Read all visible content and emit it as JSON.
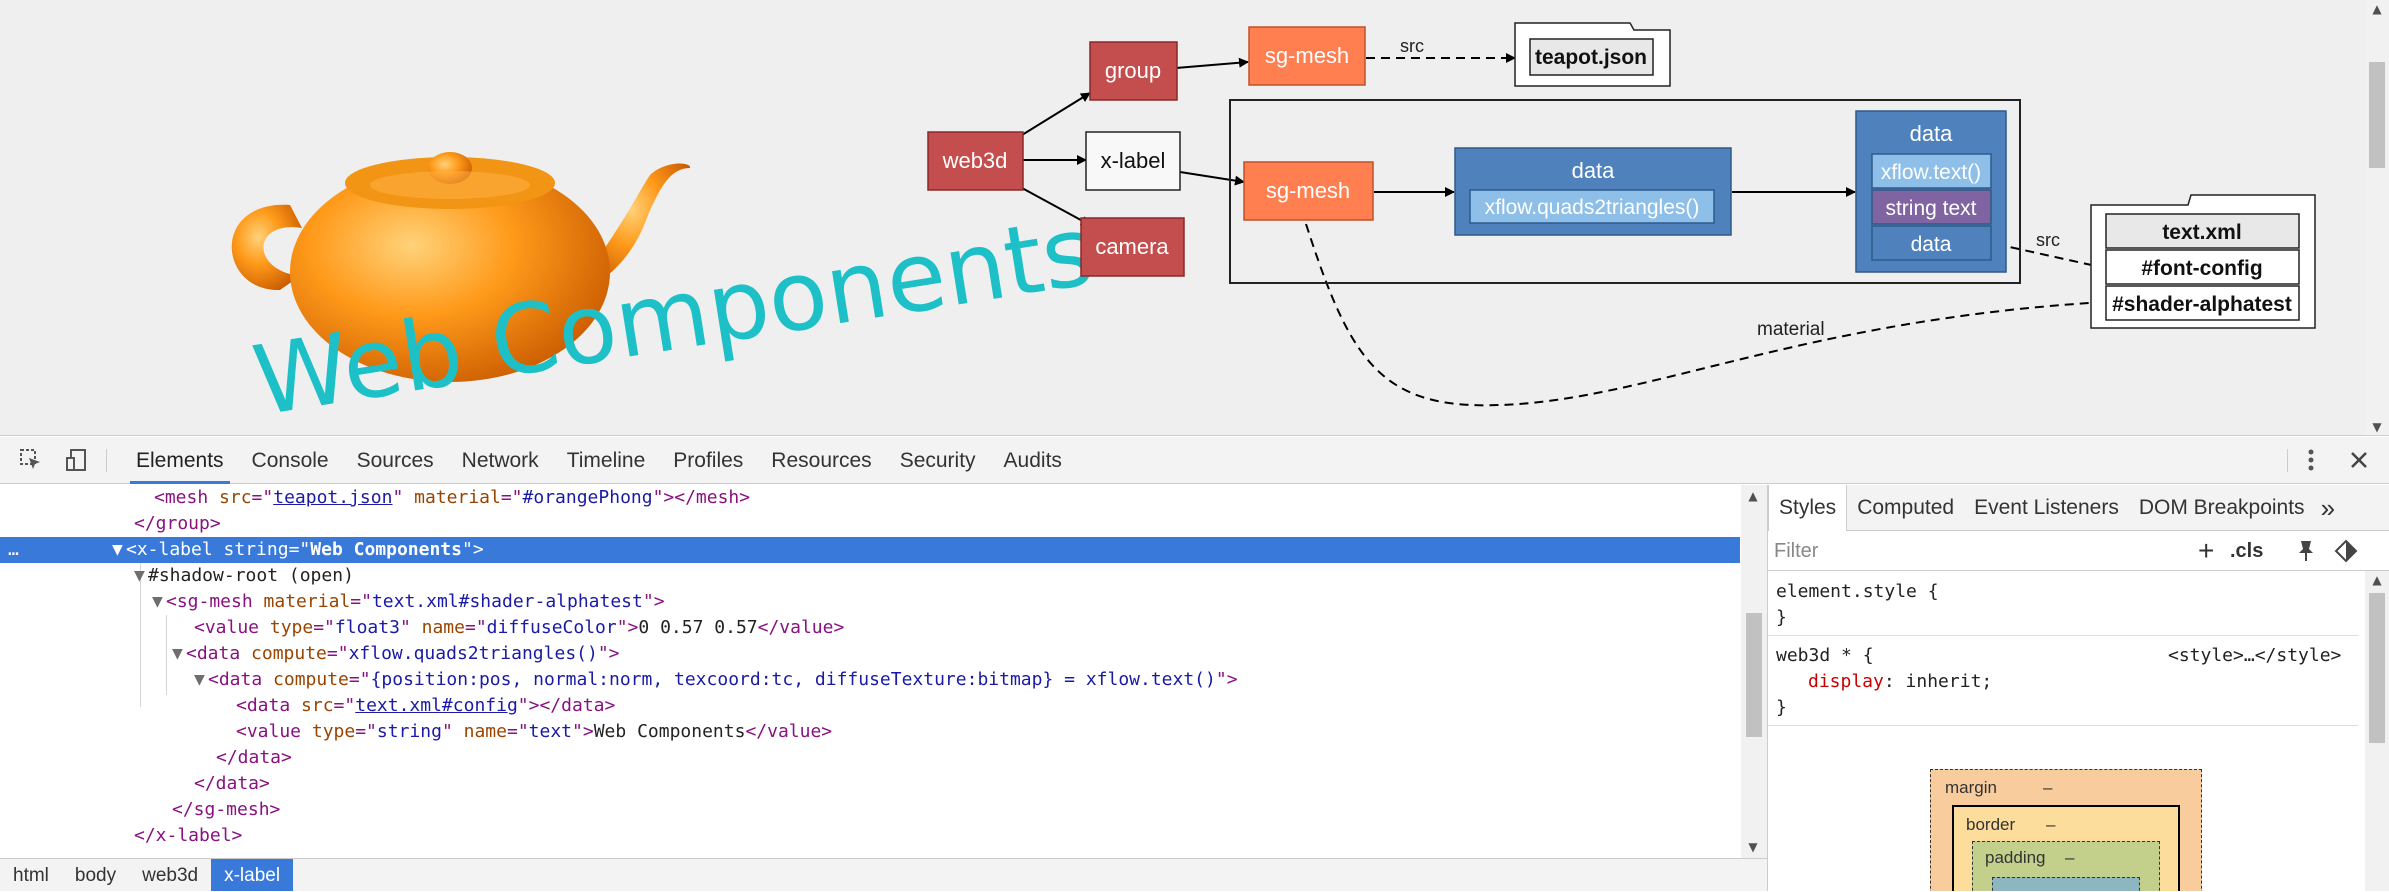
{
  "viewport": {
    "logo_text": "Web Components",
    "graph": {
      "nodes": {
        "web3d": "web3d",
        "group": "group",
        "x_label": "x-label",
        "camera": "camera",
        "sg_mesh_top": "sg-mesh",
        "sg_mesh_mid": "sg-mesh",
        "teapot_json": "teapot.json",
        "data_quads_title": "data",
        "data_quads_item": "xflow.quads2triangles()",
        "data_text_title": "data",
        "data_text_items": [
          "xflow.text()",
          "string text",
          "data"
        ],
        "text_xml_title": "text.xml",
        "text_xml_items": [
          "#font-config",
          "#shader-alphatest"
        ]
      },
      "edge_labels": {
        "src_top": "src",
        "src_right": "src",
        "material": "material"
      },
      "colors": {
        "red_node": "#c44d4d",
        "orange_node": "#ff7f50",
        "blue_data": "#4f81bd",
        "light_blue_item": "#8dbfe8",
        "purple_item": "#8064a2",
        "logo_text": "#1ec0c8",
        "teapot": "#ff9a1a"
      }
    }
  },
  "devtools": {
    "toolbar": {
      "inspect_icon": "cursor-select-icon",
      "device_icon": "device-mode-icon",
      "tabs": [
        "Elements",
        "Console",
        "Sources",
        "Network",
        "Timeline",
        "Profiles",
        "Resources",
        "Security",
        "Audits"
      ],
      "active_tab": "Elements",
      "more_icon": "vertical-ellipsis-icon",
      "close_icon": "close-icon"
    },
    "elements": {
      "lines": {
        "l0": {
          "t1": "<mesh ",
          "a1": "src",
          "e1": "=\"",
          "v1": "teapot.json",
          "e2": "\" ",
          "a2": "material",
          "e3": "=\"",
          "v2": "#orangePhong",
          "t2": "\"></mesh>"
        },
        "l1": {
          "t1": "</group>"
        },
        "l2": {
          "dots": "…",
          "tri": "▼",
          "t1": "<x-label ",
          "a1": "string",
          "e1": "=\"",
          "v1": "Web Components",
          "t2": "\">"
        },
        "l3": {
          "tri": "▼",
          "text": "#shadow-root (open)"
        },
        "l4": {
          "tri": "▼",
          "t1": "<sg-mesh ",
          "a1": "material",
          "e1": "=\"",
          "v1": "text.xml#shader-alphatest",
          "t2": "\">"
        },
        "l5": {
          "t1": "<value ",
          "a1": "type",
          "e1": "=\"",
          "v1": "float3",
          "e2": "\" ",
          "a2": "name",
          "e3": "=\"",
          "v2": "diffuseColor",
          "t2": "\">",
          "text": "0 0.57 0.57",
          "t3": "</value>"
        },
        "l6": {
          "tri": "▼",
          "t1": "<data ",
          "a1": "compute",
          "e1": "=\"",
          "v1": "xflow.quads2triangles()",
          "t2": "\">"
        },
        "l7": {
          "tri": "▼",
          "t1": "<data ",
          "a1": "compute",
          "e1": "=\"",
          "v1": "{position:pos, normal:norm, texcoord:tc, diffuseTexture:bitmap} = xflow.text()",
          "t2": "\">"
        },
        "l8": {
          "t1": "<data ",
          "a1": "src",
          "e1": "=\"",
          "v1": "text.xml#config",
          "t2": "\"></data>"
        },
        "l9": {
          "t1": "<value ",
          "a1": "type",
          "e1": "=\"",
          "v1": "string",
          "e2": "\" ",
          "a2": "name",
          "e3": "=\"",
          "v2": "text",
          "t2": "\">",
          "text": "Web Components",
          "t3": "</value>"
        },
        "l10": {
          "t1": "</data>"
        },
        "l11": {
          "t1": "</data>"
        },
        "l12": {
          "t1": "</sg-mesh>"
        },
        "l13": {
          "t1": "</x-label>"
        }
      }
    },
    "breadcrumbs": [
      "html",
      "body",
      "web3d",
      "x-label"
    ],
    "sidebar": {
      "tabs": [
        "Styles",
        "Computed",
        "Event Listeners",
        "DOM Breakpoints"
      ],
      "more": "»",
      "filter_placeholder": "Filter",
      "add_rule": "+",
      "cls_toggle": ".cls",
      "rules": {
        "element_style": {
          "selector": "element.style {",
          "close": "}"
        },
        "web3d_rule": {
          "selector": "web3d * {",
          "source": "<style>…</style>",
          "prop": "display",
          "colon": ": ",
          "value": "inherit",
          "semi": ";",
          "close": "}"
        }
      },
      "box_model": {
        "margin": "margin",
        "margin_val": "–",
        "border": "border",
        "border_val": "–",
        "padding": "padding",
        "padding_val": "–"
      }
    }
  }
}
